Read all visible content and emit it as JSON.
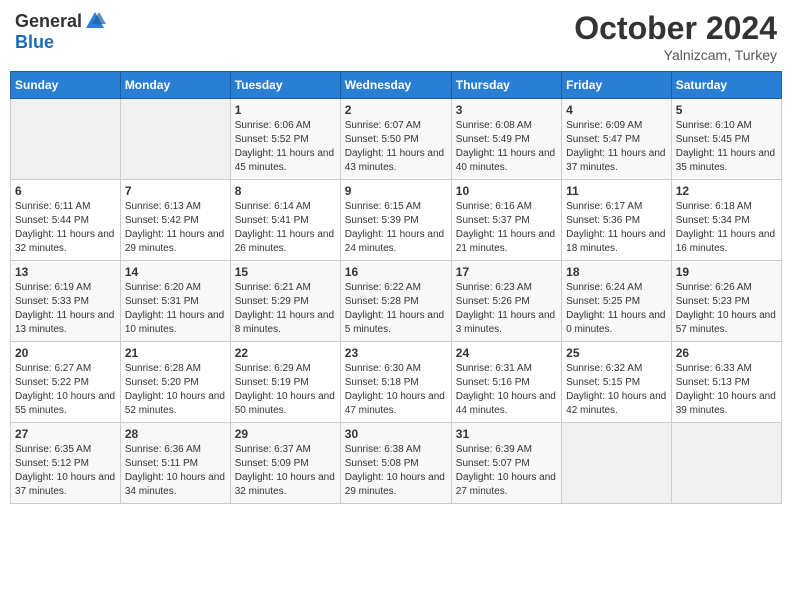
{
  "header": {
    "logo_general": "General",
    "logo_blue": "Blue",
    "month_title": "October 2024",
    "subtitle": "Yalnizcam, Turkey"
  },
  "weekdays": [
    "Sunday",
    "Monday",
    "Tuesday",
    "Wednesday",
    "Thursday",
    "Friday",
    "Saturday"
  ],
  "weeks": [
    [
      {
        "day": "",
        "sunrise": "",
        "sunset": "",
        "daylight": ""
      },
      {
        "day": "",
        "sunrise": "",
        "sunset": "",
        "daylight": ""
      },
      {
        "day": "1",
        "sunrise": "Sunrise: 6:06 AM",
        "sunset": "Sunset: 5:52 PM",
        "daylight": "Daylight: 11 hours and 45 minutes."
      },
      {
        "day": "2",
        "sunrise": "Sunrise: 6:07 AM",
        "sunset": "Sunset: 5:50 PM",
        "daylight": "Daylight: 11 hours and 43 minutes."
      },
      {
        "day": "3",
        "sunrise": "Sunrise: 6:08 AM",
        "sunset": "Sunset: 5:49 PM",
        "daylight": "Daylight: 11 hours and 40 minutes."
      },
      {
        "day": "4",
        "sunrise": "Sunrise: 6:09 AM",
        "sunset": "Sunset: 5:47 PM",
        "daylight": "Daylight: 11 hours and 37 minutes."
      },
      {
        "day": "5",
        "sunrise": "Sunrise: 6:10 AM",
        "sunset": "Sunset: 5:45 PM",
        "daylight": "Daylight: 11 hours and 35 minutes."
      }
    ],
    [
      {
        "day": "6",
        "sunrise": "Sunrise: 6:11 AM",
        "sunset": "Sunset: 5:44 PM",
        "daylight": "Daylight: 11 hours and 32 minutes."
      },
      {
        "day": "7",
        "sunrise": "Sunrise: 6:13 AM",
        "sunset": "Sunset: 5:42 PM",
        "daylight": "Daylight: 11 hours and 29 minutes."
      },
      {
        "day": "8",
        "sunrise": "Sunrise: 6:14 AM",
        "sunset": "Sunset: 5:41 PM",
        "daylight": "Daylight: 11 hours and 26 minutes."
      },
      {
        "day": "9",
        "sunrise": "Sunrise: 6:15 AM",
        "sunset": "Sunset: 5:39 PM",
        "daylight": "Daylight: 11 hours and 24 minutes."
      },
      {
        "day": "10",
        "sunrise": "Sunrise: 6:16 AM",
        "sunset": "Sunset: 5:37 PM",
        "daylight": "Daylight: 11 hours and 21 minutes."
      },
      {
        "day": "11",
        "sunrise": "Sunrise: 6:17 AM",
        "sunset": "Sunset: 5:36 PM",
        "daylight": "Daylight: 11 hours and 18 minutes."
      },
      {
        "day": "12",
        "sunrise": "Sunrise: 6:18 AM",
        "sunset": "Sunset: 5:34 PM",
        "daylight": "Daylight: 11 hours and 16 minutes."
      }
    ],
    [
      {
        "day": "13",
        "sunrise": "Sunrise: 6:19 AM",
        "sunset": "Sunset: 5:33 PM",
        "daylight": "Daylight: 11 hours and 13 minutes."
      },
      {
        "day": "14",
        "sunrise": "Sunrise: 6:20 AM",
        "sunset": "Sunset: 5:31 PM",
        "daylight": "Daylight: 11 hours and 10 minutes."
      },
      {
        "day": "15",
        "sunrise": "Sunrise: 6:21 AM",
        "sunset": "Sunset: 5:29 PM",
        "daylight": "Daylight: 11 hours and 8 minutes."
      },
      {
        "day": "16",
        "sunrise": "Sunrise: 6:22 AM",
        "sunset": "Sunset: 5:28 PM",
        "daylight": "Daylight: 11 hours and 5 minutes."
      },
      {
        "day": "17",
        "sunrise": "Sunrise: 6:23 AM",
        "sunset": "Sunset: 5:26 PM",
        "daylight": "Daylight: 11 hours and 3 minutes."
      },
      {
        "day": "18",
        "sunrise": "Sunrise: 6:24 AM",
        "sunset": "Sunset: 5:25 PM",
        "daylight": "Daylight: 11 hours and 0 minutes."
      },
      {
        "day": "19",
        "sunrise": "Sunrise: 6:26 AM",
        "sunset": "Sunset: 5:23 PM",
        "daylight": "Daylight: 10 hours and 57 minutes."
      }
    ],
    [
      {
        "day": "20",
        "sunrise": "Sunrise: 6:27 AM",
        "sunset": "Sunset: 5:22 PM",
        "daylight": "Daylight: 10 hours and 55 minutes."
      },
      {
        "day": "21",
        "sunrise": "Sunrise: 6:28 AM",
        "sunset": "Sunset: 5:20 PM",
        "daylight": "Daylight: 10 hours and 52 minutes."
      },
      {
        "day": "22",
        "sunrise": "Sunrise: 6:29 AM",
        "sunset": "Sunset: 5:19 PM",
        "daylight": "Daylight: 10 hours and 50 minutes."
      },
      {
        "day": "23",
        "sunrise": "Sunrise: 6:30 AM",
        "sunset": "Sunset: 5:18 PM",
        "daylight": "Daylight: 10 hours and 47 minutes."
      },
      {
        "day": "24",
        "sunrise": "Sunrise: 6:31 AM",
        "sunset": "Sunset: 5:16 PM",
        "daylight": "Daylight: 10 hours and 44 minutes."
      },
      {
        "day": "25",
        "sunrise": "Sunrise: 6:32 AM",
        "sunset": "Sunset: 5:15 PM",
        "daylight": "Daylight: 10 hours and 42 minutes."
      },
      {
        "day": "26",
        "sunrise": "Sunrise: 6:33 AM",
        "sunset": "Sunset: 5:13 PM",
        "daylight": "Daylight: 10 hours and 39 minutes."
      }
    ],
    [
      {
        "day": "27",
        "sunrise": "Sunrise: 6:35 AM",
        "sunset": "Sunset: 5:12 PM",
        "daylight": "Daylight: 10 hours and 37 minutes."
      },
      {
        "day": "28",
        "sunrise": "Sunrise: 6:36 AM",
        "sunset": "Sunset: 5:11 PM",
        "daylight": "Daylight: 10 hours and 34 minutes."
      },
      {
        "day": "29",
        "sunrise": "Sunrise: 6:37 AM",
        "sunset": "Sunset: 5:09 PM",
        "daylight": "Daylight: 10 hours and 32 minutes."
      },
      {
        "day": "30",
        "sunrise": "Sunrise: 6:38 AM",
        "sunset": "Sunset: 5:08 PM",
        "daylight": "Daylight: 10 hours and 29 minutes."
      },
      {
        "day": "31",
        "sunrise": "Sunrise: 6:39 AM",
        "sunset": "Sunset: 5:07 PM",
        "daylight": "Daylight: 10 hours and 27 minutes."
      },
      {
        "day": "",
        "sunrise": "",
        "sunset": "",
        "daylight": ""
      },
      {
        "day": "",
        "sunrise": "",
        "sunset": "",
        "daylight": ""
      }
    ]
  ]
}
